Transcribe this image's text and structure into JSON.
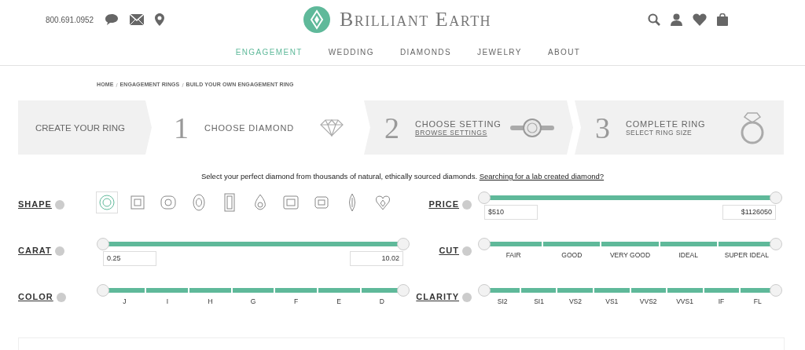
{
  "header": {
    "phone": "800.691.0952",
    "logo": "Brilliant Earth"
  },
  "nav": [
    {
      "label": "ENGAGEMENT",
      "selected": true
    },
    {
      "label": "WEDDING",
      "selected": false
    },
    {
      "label": "DIAMONDS",
      "selected": false
    },
    {
      "label": "JEWELRY",
      "selected": false
    },
    {
      "label": "ABOUT",
      "selected": false
    }
  ],
  "breadcrumb": [
    {
      "kind": "link",
      "label": "HOME"
    },
    {
      "kind": "separator",
      "label": "/"
    },
    {
      "kind": "link",
      "label": "ENGAGEMENT RINGS"
    },
    {
      "kind": "separator",
      "label": "/"
    },
    {
      "kind": "link",
      "label": "BUILD YOUR OWN ENGAGEMENT RING"
    }
  ],
  "steps": {
    "label": "CREATE YOUR RING",
    "items": [
      {
        "number": "1",
        "title": "CHOOSE DIAMOND",
        "kind": "diamond",
        "selected": true
      },
      {
        "number": "2",
        "title": "CHOOSE SETTING",
        "link": "BROWSE SETTINGS",
        "kind": "setting",
        "selected": false
      },
      {
        "number": "3",
        "title": "COMPLETE RING",
        "subtitle": "SELECT RING SIZE",
        "kind": "ring",
        "selected": false
      }
    ]
  },
  "intro": {
    "text": "Select your perfect diamond from thousands of natural, ethically sourced diamonds.",
    "link": "Searching for a lab created diamond?"
  },
  "filters": [
    {
      "label": "SHAPE",
      "kind": "shapes",
      "shapes": [
        {
          "kind": "round",
          "selected": true
        },
        {
          "kind": "princess",
          "selected": false
        },
        {
          "kind": "cushion",
          "selected": false
        },
        {
          "kind": "oval",
          "selected": false
        },
        {
          "kind": "emerald",
          "selected": false
        },
        {
          "kind": "pear",
          "selected": false
        },
        {
          "kind": "asscher",
          "selected": false
        },
        {
          "kind": "radiant",
          "selected": false
        },
        {
          "kind": "marquise",
          "selected": false
        },
        {
          "kind": "heart",
          "selected": false
        }
      ]
    },
    {
      "label": "PRICE",
      "kind": "range",
      "thumbs": [
        {
          "level": 0
        },
        {
          "level": 1
        }
      ],
      "values": [
        "$510",
        "$1126050"
      ]
    },
    {
      "label": "CARAT",
      "kind": "range",
      "thumbs": [
        {
          "level": 0
        },
        {
          "level": 1
        }
      ],
      "values": [
        "0.25",
        "10.02"
      ]
    },
    {
      "label": "CUT",
      "kind": "grades",
      "thumbs": [
        {
          "level": 0
        },
        {
          "level": 1
        }
      ],
      "grades": [
        "FAIR",
        "GOOD",
        "VERY GOOD",
        "IDEAL",
        "SUPER IDEAL"
      ]
    },
    {
      "label": "COLOR",
      "kind": "grades",
      "thumbs": [
        {
          "level": 0
        },
        {
          "level": 1
        }
      ],
      "grades": [
        "J",
        "I",
        "H",
        "G",
        "F",
        "E",
        "D"
      ]
    },
    {
      "label": "CLARITY",
      "kind": "grades",
      "thumbs": [
        {
          "level": 0
        },
        {
          "level": 1
        }
      ],
      "grades": [
        "SI2",
        "SI1",
        "VS2",
        "VS1",
        "VVS2",
        "VVS1",
        "IF",
        "FL"
      ]
    }
  ]
}
